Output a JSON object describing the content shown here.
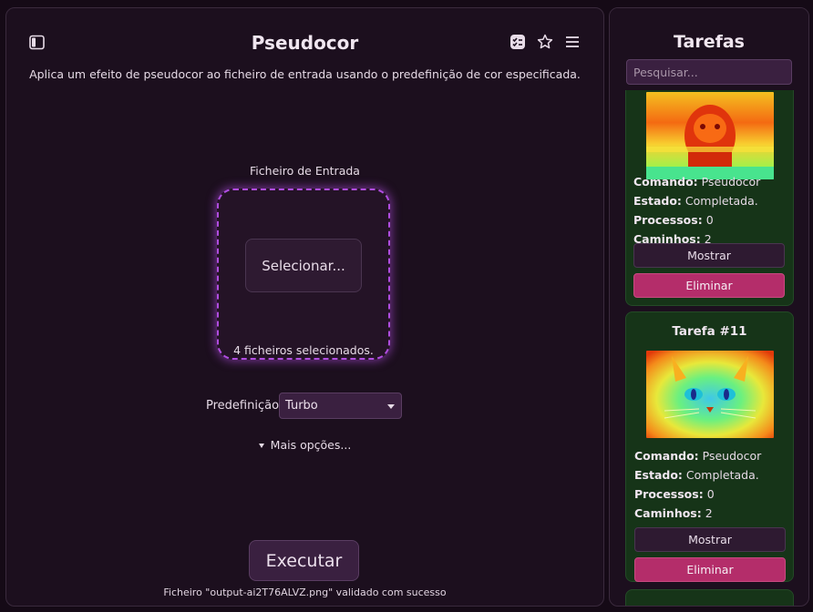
{
  "main": {
    "title": "Pseudocor",
    "description": "Aplica um efeito de pseudocor ao ficheiro de entrada usando o predefinição de cor especificada.",
    "icons": {
      "sidebar_toggle": "sidebar-toggle-icon",
      "tasks": "tasks-icon",
      "favorite": "star-icon",
      "menu": "menu-icon"
    },
    "input_label": "Ficheiro de Entrada",
    "select_button": "Selecionar...",
    "files_selected": "4 ficheiros selecionados.",
    "preset_label": "Predefinição",
    "preset_value": "Turbo",
    "more_options": "Mais opções...",
    "run_button": "Executar",
    "status": "Ficheiro \"output-ai2T76ALVZ.png\" validado com sucesso"
  },
  "sidebar": {
    "title": "Tarefas",
    "search_placeholder": "Pesquisar...",
    "tasks": [
      {
        "title": "",
        "command_label": "Comando:",
        "command": "Pseudocor",
        "state_label": "Estado:",
        "state": "Completada.",
        "processes_label": "Processos:",
        "processes": "0",
        "paths_label": "Caminhos:",
        "paths": "2",
        "show_button": "Mostrar",
        "delete_button": "Eliminar"
      },
      {
        "title": "Tarefa #11",
        "command_label": "Comando:",
        "command": "Pseudocor",
        "state_label": "Estado:",
        "state": "Completada.",
        "processes_label": "Processos:",
        "processes": "0",
        "paths_label": "Caminhos:",
        "paths": "2",
        "show_button": "Mostrar",
        "delete_button": "Eliminar"
      }
    ]
  },
  "colors": {
    "background": "#150a16",
    "panel": "#1c0f1e",
    "accent": "#b04de0",
    "task_card": "#163418",
    "delete": "#b42d6a"
  }
}
